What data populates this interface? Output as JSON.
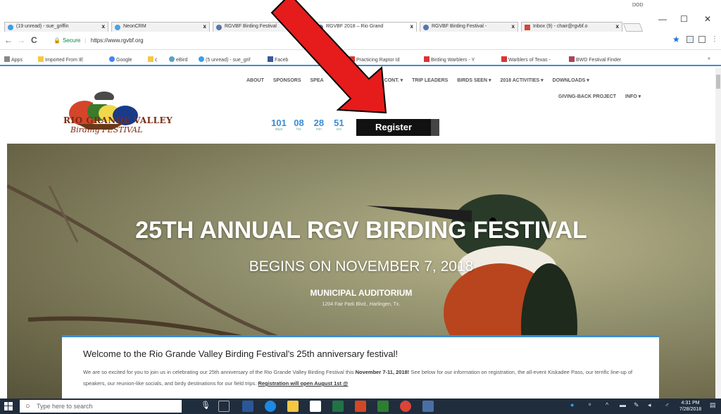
{
  "browser": {
    "tabs": [
      {
        "label": "(19 unread) - sue_griffin",
        "color": "#3aa0e8"
      },
      {
        "label": "NeonCRM",
        "color": "#4aa3df"
      },
      {
        "label": "RGVBF Birding Festival",
        "color": "#5577aa"
      },
      {
        "label": "RGVBF 2018 – Rio Grand",
        "color": "#5577aa"
      },
      {
        "label": "RGVBF Birding Festival -",
        "color": "#5577aa"
      },
      {
        "label": "Inbox (9) - chair@rgvbf.o",
        "color": "#d44638"
      }
    ],
    "window_note": "DOD",
    "window_min": "—",
    "window_max": "☐",
    "window_close": "✕",
    "nav_back": "←",
    "nav_forward": "→",
    "nav_reload": "C",
    "secure_label": "Secure",
    "url": "https://www.rgvbf.org",
    "bookmarks": [
      {
        "label": "Apps",
        "color": "#888"
      },
      {
        "label": "Imported From IE",
        "color": "#f5c842"
      },
      {
        "label": "Google",
        "color": "#4285f4"
      },
      {
        "label": "c",
        "color": "#f5c842"
      },
      {
        "label": "eBird",
        "color": "#5aa0c8"
      },
      {
        "label": "(5 unread) - sue_grif",
        "color": "#3aa0e8"
      },
      {
        "label": "Faceb",
        "color": "#3b5998"
      },
      {
        "label": "Practicing Raptor Id",
        "color": "#d33"
      },
      {
        "label": "Birding Warblers - Y",
        "color": "#d33"
      },
      {
        "label": "Warblers of Texas -",
        "color": "#d33"
      },
      {
        "label": "BWD Festival Finder",
        "color": "#a45"
      }
    ],
    "bookmarks_more": "»"
  },
  "site": {
    "logo_line1": "RIO GRANDE VALLEY",
    "logo_line2": "Birding FESTIVAL",
    "nav_row1": [
      "ABOUT",
      "SPONSORS",
      "SPEA",
      "ART & WRIT CONT. ▾",
      "TRIP LEADERS",
      "BIRDS SEEN ▾",
      "2018 ACTIVITIES ▾",
      "DOWNLOADS ▾"
    ],
    "nav_row2": [
      "GIVING-BACK PROJECT",
      "INFO ▾"
    ],
    "countdown": [
      {
        "num": "101",
        "unit": "days"
      },
      {
        "num": "08",
        "unit": "hrs"
      },
      {
        "num": "28",
        "unit": "min"
      },
      {
        "num": "51",
        "unit": "sec"
      }
    ],
    "register_label": "Register",
    "hero_title": "25TH ANNUAL RGV BIRDING FESTIVAL",
    "hero_subtitle": "BEGINS ON NOVEMBER 7, 2018",
    "hero_venue": "MUNICIPAL AUDITORIUM",
    "hero_address": "1204 Fair Park Blvd., Harlingen, Tx.",
    "welcome_title": "Welcome to the Rio Grande Valley Birding Festival's 25th anniversary festival!",
    "welcome_p_a": "We are so excited for you to join us in celebrating our 25th anniversary of the Rio Grande Valley Birding Festival this ",
    "welcome_p_dates": "November 7-11, 2018!",
    "welcome_p_b": " See below for our information on registration, the all-event Kiskadee Pass, our terrific line-up of speakers, our reunion-like socials, and birdy destinations for our field trips. ",
    "welcome_p_link": "Registration will open August 1st @"
  },
  "taskbar": {
    "search_placeholder": "Type here to search",
    "time": "4:31 PM",
    "date": "7/28/2018"
  }
}
